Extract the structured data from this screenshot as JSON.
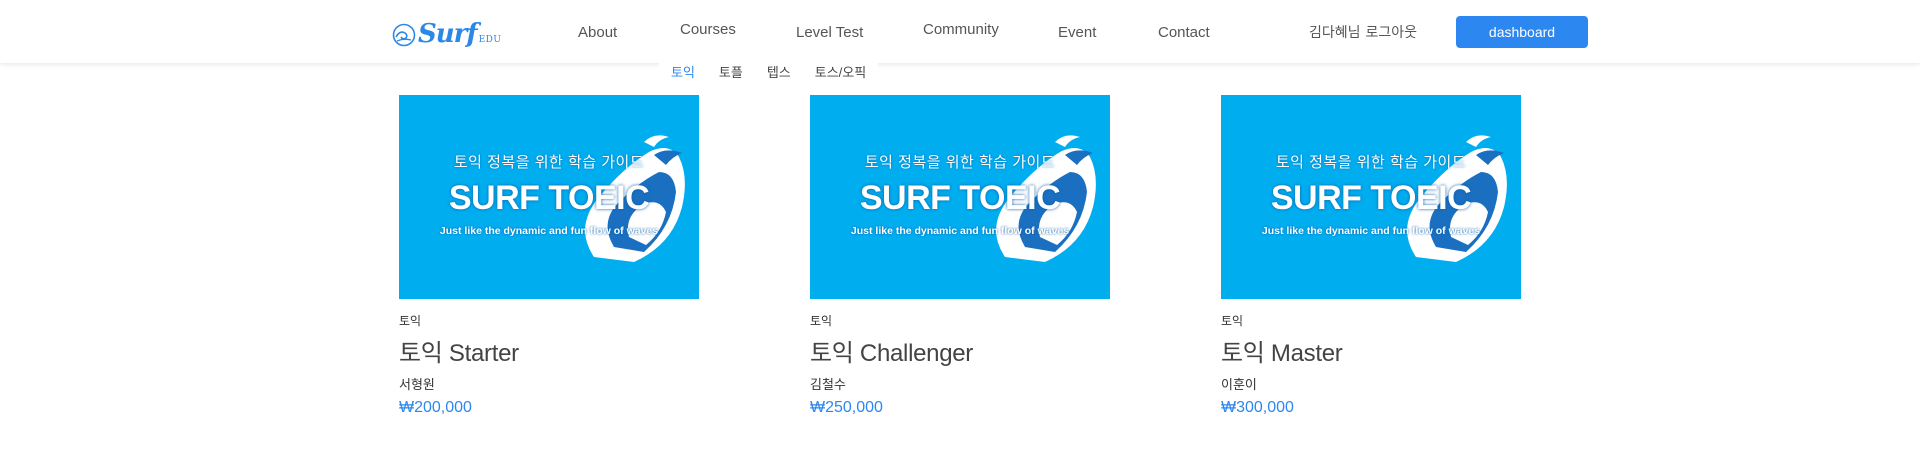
{
  "brand": {
    "logo_text": "Surf",
    "logo_sub": "EDU",
    "color": "#2b88e6"
  },
  "nav": {
    "items": [
      "About",
      "Courses",
      "Level Test",
      "Community",
      "Event",
      "Contact"
    ]
  },
  "user": {
    "name": "김다혜님",
    "logout_label": "로그아웃"
  },
  "dashboard": {
    "label": "dashboard",
    "color": "#2d87f0"
  },
  "subnav": {
    "items": [
      "토익",
      "토플",
      "텝스",
      "토스/오픽"
    ],
    "active": "토익"
  },
  "courses": [
    {
      "thumbnail": {
        "subtitle": "토익 정복을 위한 학습 가이드",
        "title": "SURF TOEIC",
        "tagline": "Just like the dynamic and fun flow of waves"
      },
      "category": "토익",
      "title": "토익 Starter",
      "instructor": "서형원",
      "price": "₩200,000"
    },
    {
      "thumbnail": {
        "subtitle": "토익 정복을 위한 학습 가이드",
        "title": "SURF TOEIC",
        "tagline": "Just like the dynamic and fun flow of waves"
      },
      "category": "토익",
      "title": "토익 Challenger",
      "instructor": "김철수",
      "price": "₩250,000"
    },
    {
      "thumbnail": {
        "subtitle": "토익 정복을 위한 학습 가이드",
        "title": "SURF TOEIC",
        "tagline": "Just like the dynamic and fun flow of waves"
      },
      "category": "토익",
      "title": "토익 Master",
      "instructor": "이훈이",
      "price": "₩300,000"
    }
  ],
  "colors": {
    "thumbnail_bg": "#00adef",
    "accent": "#2d87f0"
  }
}
